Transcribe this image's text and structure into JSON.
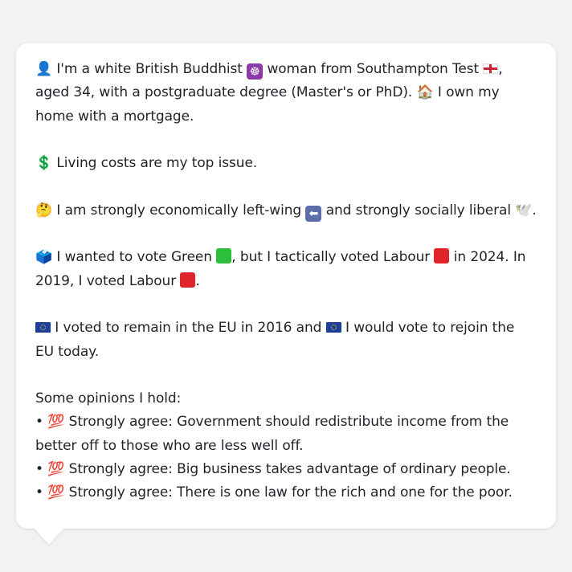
{
  "profile": {
    "intro": {
      "person_icon": "👤",
      "text_a": " I'm a white British Buddhist ",
      "text_b": " woman from Southampton Test ",
      "text_c": ", aged 34, with a postgraduate degree (Master's or PhD). ",
      "home_icon": "🏠",
      "text_d": " I own my home with a mortgage."
    },
    "issue": {
      "icon": "💲",
      "text": " Living costs are my top issue."
    },
    "ideology": {
      "icon": "🤔",
      "text_a": " I am strongly economically left-wing ",
      "text_b": " and strongly socially liberal ",
      "dove_icon": "🕊️",
      "text_c": "."
    },
    "vote": {
      "icon": "🗳️",
      "text_a": " I wanted to vote Green ",
      "text_b": ", but I tactically voted Labour ",
      "text_c": " in 2024. In 2019, I voted Labour ",
      "text_d": "."
    },
    "eu": {
      "text_a": " I voted to remain in the EU in 2016 and ",
      "text_b": " I would vote to rejoin the EU today."
    },
    "opinions": {
      "heading": "Some opinions I hold:",
      "bullet": "•",
      "icon_text": "💯",
      "items": [
        " Strongly agree: Government should redistribute income from the better off to those who are less well off.",
        " Strongly agree: Big business takes advantage of ordinary people.",
        " Strongly agree: There is one law for the rich and one for the poor."
      ]
    }
  },
  "colors": {
    "green_party": "#2dbf3b",
    "labour": "#e0262c",
    "eu_blue": "#1d3f9a"
  },
  "icons": [
    "person-icon",
    "dharma-wheel-icon",
    "england-flag-icon",
    "house-icon",
    "dollar-icon",
    "thinking-face-icon",
    "left-arrow-icon",
    "dove-icon",
    "ballot-box-icon",
    "green-square-icon",
    "red-square-icon",
    "eu-flag-icon",
    "hundred-points-icon"
  ]
}
